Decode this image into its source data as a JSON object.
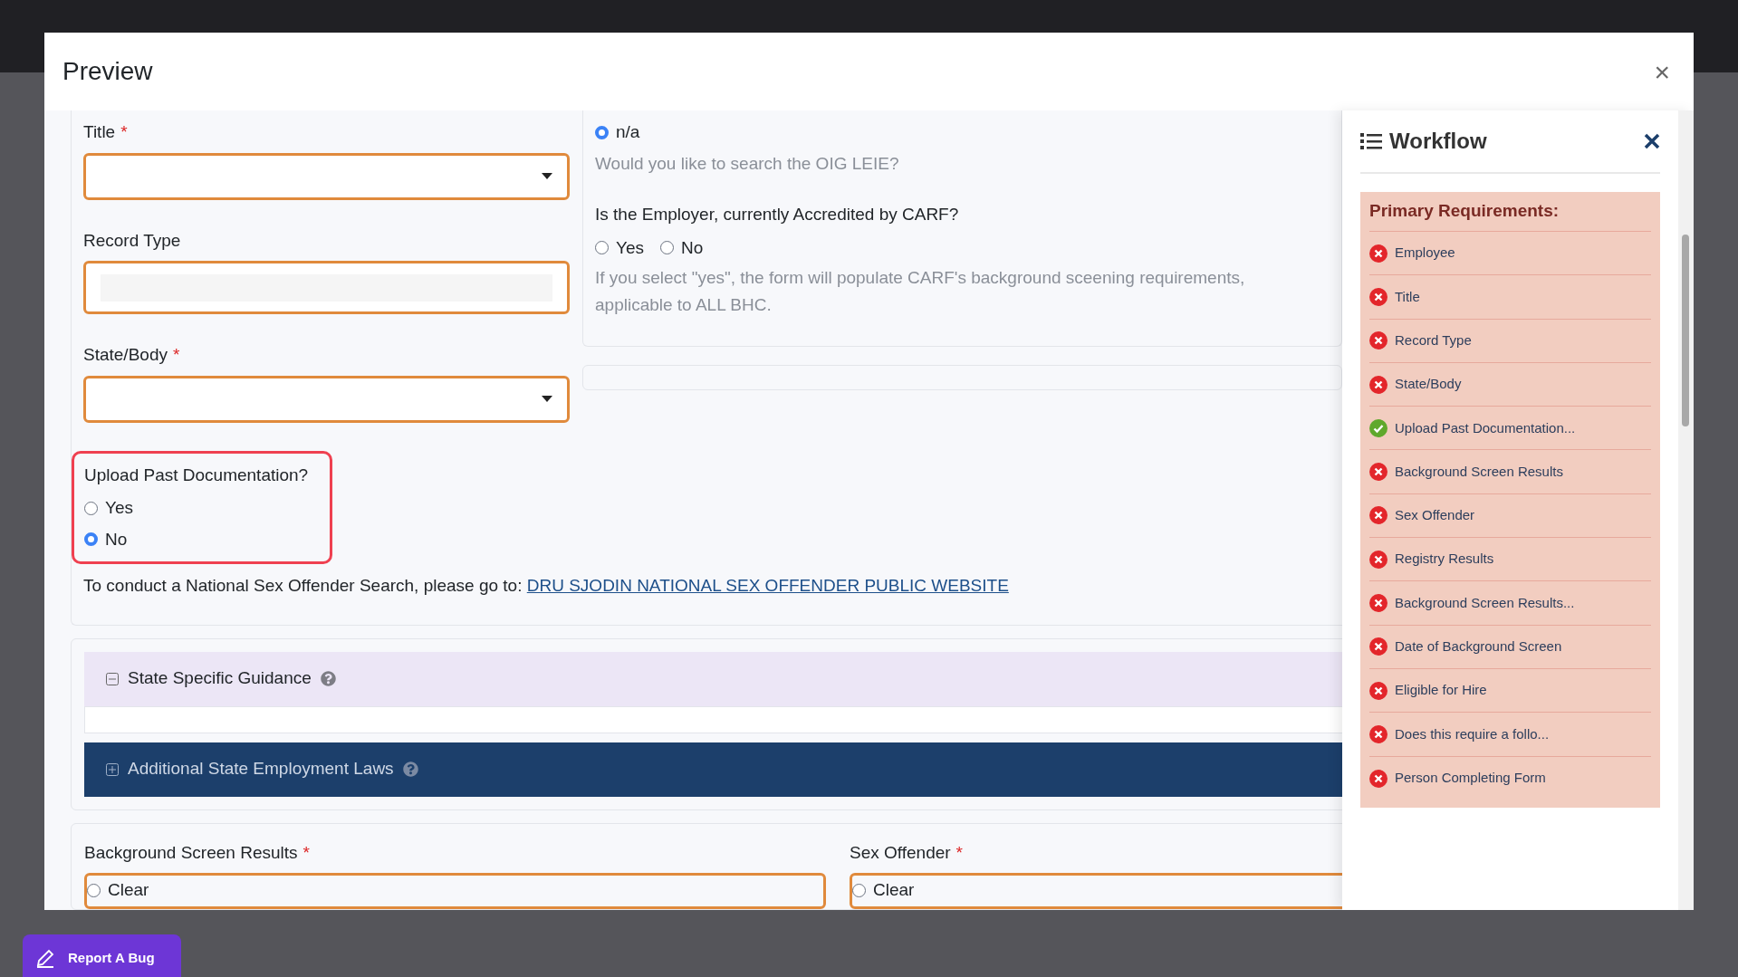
{
  "modal": {
    "title": "Preview",
    "close": "×"
  },
  "fields": [
    {
      "label": "Title",
      "required_mark": "*",
      "kind": "select"
    },
    {
      "label": "Record Type",
      "kind": "text"
    },
    {
      "label": "State/Body",
      "required_mark": "*",
      "kind": "select"
    }
  ],
  "upload_question": {
    "label": "Upload Past Documentation?",
    "options": [
      {
        "label": "Yes",
        "selected": false
      },
      {
        "label": "No",
        "selected": true
      }
    ]
  },
  "oig": {
    "options": [
      {
        "label": "n/a",
        "selected": true
      }
    ],
    "hint": "Would you like to search the OIG LEIE?"
  },
  "carf": {
    "label": "Is the Employer, currently Accredited by CARF?",
    "options": [
      {
        "label": "Yes",
        "selected": false
      },
      {
        "label": "No",
        "selected": false
      }
    ],
    "hint": "If you select \"yes\", the form will populate CARF's background sceening requirements, applicable to ALL BHC."
  },
  "offender_note": {
    "text": "To conduct a National Sex Offender Search, please go to:",
    "link": "DRU SJODIN NATIONAL SEX OFFENDER PUBLIC WEBSITE"
  },
  "accordions": [
    {
      "title": "State Specific Guidance",
      "expanded": true
    },
    {
      "title": "Additional State Employment Laws",
      "expanded": false
    }
  ],
  "bottom_fields": [
    {
      "label": "Background Screen Results",
      "required_mark": "*",
      "options": [
        {
          "label": "Clear",
          "selected": false
        }
      ]
    },
    {
      "label": "Sex Offender",
      "required_mark": "*",
      "options": [
        {
          "label": "Clear",
          "selected": false
        }
      ]
    }
  ],
  "workflow": {
    "title": "Workflow",
    "section": "Primary Requirements:",
    "items": [
      {
        "label": "Employee",
        "complete": false
      },
      {
        "label": "Title",
        "complete": false
      },
      {
        "label": "Record Type",
        "complete": false
      },
      {
        "label": "State/Body",
        "complete": false
      },
      {
        "label": "Upload Past Documentation...",
        "complete": true
      },
      {
        "label": "Background Screen Results",
        "complete": false
      },
      {
        "label": "Sex Offender",
        "complete": false
      },
      {
        "label": "Registry Results",
        "complete": false
      },
      {
        "label": "Background Screen Results...",
        "complete": false
      },
      {
        "label": "Date of Background Screen",
        "complete": false
      },
      {
        "label": "Eligible for Hire",
        "complete": false
      },
      {
        "label": "Does this require a follo...",
        "complete": false
      },
      {
        "label": "Person Completing Form",
        "complete": false
      }
    ]
  },
  "report_bug": "Report A Bug"
}
